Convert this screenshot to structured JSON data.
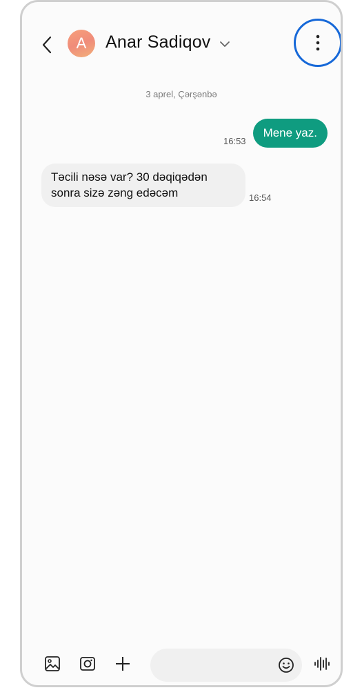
{
  "header": {
    "avatar_letter": "A",
    "contact_name": "Anar Sadiqov"
  },
  "conversation": {
    "date_separator": "3 aprel, Çərşənbə",
    "messages": [
      {
        "direction": "outgoing",
        "text": "Mene yaz.",
        "time": "16:53"
      },
      {
        "direction": "incoming",
        "text": "Təcili nəsə var? 30 dəqiqədən sonra sizə zəng edəcəm",
        "time": "16:54"
      }
    ]
  },
  "composer": {
    "placeholder": ""
  },
  "icons": {
    "back": "chevron-left-icon",
    "name_dropdown": "chevron-down-icon",
    "more": "more-vertical-icon",
    "gallery": "image-icon",
    "camera": "camera-icon",
    "add": "plus-icon",
    "emoji": "smiley-icon",
    "voice": "voice-waveform-icon"
  },
  "colors": {
    "outgoing_bubble": "#0f9c80",
    "incoming_bubble": "#f0f0f0",
    "highlight_ring": "#1668d8"
  }
}
